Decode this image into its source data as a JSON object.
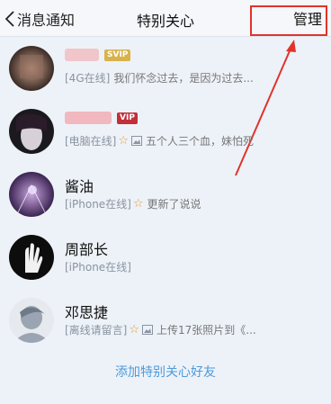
{
  "header": {
    "back_label": "消息通知",
    "title": "特别关心",
    "manage_label": "管理"
  },
  "contacts": [
    {
      "name": "",
      "badge": "SVIP",
      "status": "[4G在线]",
      "message": "我们怀念过去，是因为过去..."
    },
    {
      "name": "",
      "badge": "VIP",
      "status": "[电脑在线]",
      "message": "五个人三个血，妹怕死"
    },
    {
      "name": "酱油",
      "badge": "",
      "status": "[iPhone在线]",
      "message": "更新了说说"
    },
    {
      "name": "周部长",
      "badge": "",
      "status": "[iPhone在线]",
      "message": ""
    },
    {
      "name": "邓思捷",
      "badge": "",
      "status": "[离线请留言]",
      "message": "上传17张照片到《..."
    }
  ],
  "footer": {
    "add_label": "添加特别关心好友"
  },
  "colors": {
    "accent": "#4f9ad9",
    "highlight": "#e0332b",
    "background": "#edf2f8"
  }
}
